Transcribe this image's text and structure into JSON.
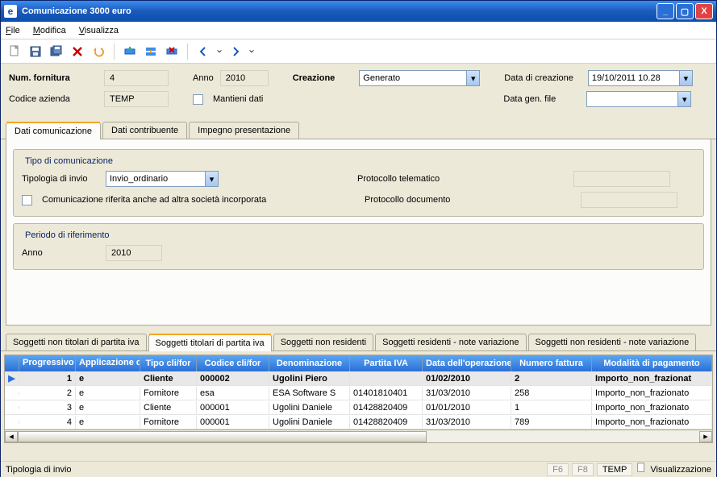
{
  "window": {
    "title": "Comunicazione 3000 euro"
  },
  "menu": {
    "file": "File",
    "modifica": "Modifica",
    "visualizza": "Visualizza"
  },
  "form": {
    "num_fornitura_label": "Num. fornitura",
    "num_fornitura_value": "4",
    "anno_label": "Anno",
    "anno_value": "2010",
    "creazione_label": "Creazione",
    "creazione_value": "Generato",
    "data_creazione_label": "Data di creazione",
    "data_creazione_value": "19/10/2011 10.28",
    "codice_azienda_label": "Codice azienda",
    "codice_azienda_value": "TEMP",
    "mantieni_dati_label": "Mantieni dati",
    "data_gen_file_label": "Data gen. file",
    "data_gen_file_value": ""
  },
  "tabs": {
    "dati_comunicazione": "Dati comunicazione",
    "dati_contribuente": "Dati contribuente",
    "impegno_presentazione": "Impegno presentazione"
  },
  "tipo_comunicazione": {
    "legend": "Tipo di comunicazione",
    "tipologia_invio_label": "Tipologia di invio",
    "tipologia_invio_value": "Invio_ordinario",
    "check_label": "Comunicazione riferita anche ad altra società incorporata",
    "protocollo_telematico_label": "Protocollo telematico",
    "protocollo_documento_label": "Protocollo documento"
  },
  "periodo": {
    "legend": "Periodo di riferimento",
    "anno_label": "Anno",
    "anno_value": "2010"
  },
  "subtabs": {
    "s1": "Soggetti non titolari di partita iva",
    "s2": "Soggetti titolari di partita iva",
    "s3": "Soggetti non residenti",
    "s4": "Soggetti residenti - note variazione",
    "s5": "Soggetti non residenti - note variazione"
  },
  "grid": {
    "headers": {
      "progressivo": "Progressivo riga",
      "applicazione": "Applicazione di provenienza",
      "tipo_clifor": "Tipo cli/for",
      "codice_clifor": "Codice cli/for",
      "denominazione": "Denominazione",
      "partita_iva": "Partita IVA",
      "data_operazione": "Data dell'operazione",
      "numero_fattura": "Numero fattura",
      "modalita_pagamento": "Modalità di pagamento"
    },
    "rows": [
      {
        "prog": "1",
        "app": "e",
        "tipo": "Cliente",
        "codice": "000002",
        "denom": "Ugolini Piero",
        "piva": "",
        "data": "01/02/2010",
        "numero": "2",
        "modalita": "Importo_non_frazionat"
      },
      {
        "prog": "2",
        "app": "e",
        "tipo": "Fornitore",
        "codice": "esa",
        "denom": "ESA Software S",
        "piva": "01401810401",
        "data": "31/03/2010",
        "numero": "258",
        "modalita": "Importo_non_frazionato"
      },
      {
        "prog": "3",
        "app": "e",
        "tipo": "Cliente",
        "codice": "000001",
        "denom": "Ugolini Daniele",
        "piva": "01428820409",
        "data": "01/01/2010",
        "numero": "1",
        "modalita": "Importo_non_frazionato"
      },
      {
        "prog": "4",
        "app": "e",
        "tipo": "Fornitore",
        "codice": "000001",
        "denom": "Ugolini Daniele",
        "piva": "01428820409",
        "data": "31/03/2010",
        "numero": "789",
        "modalita": "Importo_non_frazionato"
      }
    ]
  },
  "statusbar": {
    "left": "Tipologia di invio",
    "f6": "F6",
    "f8": "F8",
    "temp": "TEMP",
    "mode": "Visualizzazione"
  }
}
